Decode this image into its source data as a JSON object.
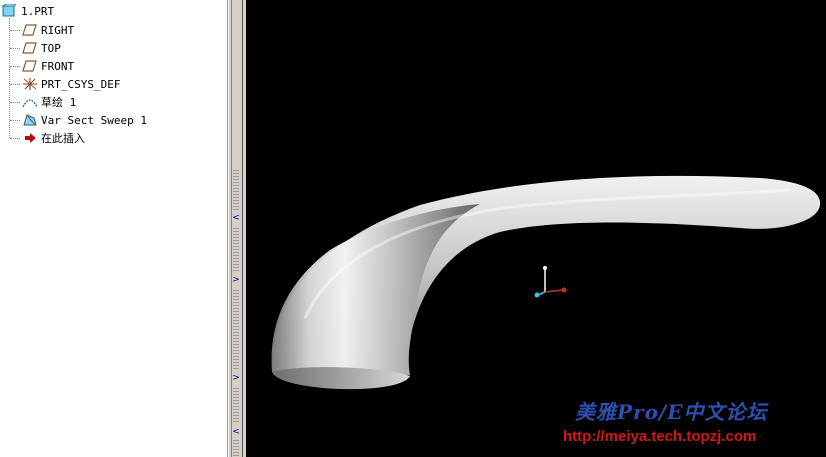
{
  "model_tree": {
    "root": "1.PRT",
    "items": [
      {
        "label": "RIGHT",
        "icon": "datum-plane-icon"
      },
      {
        "label": "TOP",
        "icon": "datum-plane-icon"
      },
      {
        "label": "FRONT",
        "icon": "datum-plane-icon"
      },
      {
        "label": "PRT_CSYS_DEF",
        "icon": "coordinate-system-icon"
      },
      {
        "label": "草绘 1",
        "icon": "sketch-icon"
      },
      {
        "label": "Var Sect Sweep 1",
        "icon": "sweep-feature-icon"
      },
      {
        "label": "在此插入",
        "icon": "insert-here-arrow-icon"
      }
    ]
  },
  "watermark": {
    "line1": "美雅Pro/E中文论坛",
    "line2": "http://meiya.tech.topzj.com"
  },
  "colors": {
    "viewport_bg": "#000000",
    "tree_bg": "#ffffff",
    "watermark_blue": "#2f4fb0",
    "watermark_red": "#d01818"
  }
}
